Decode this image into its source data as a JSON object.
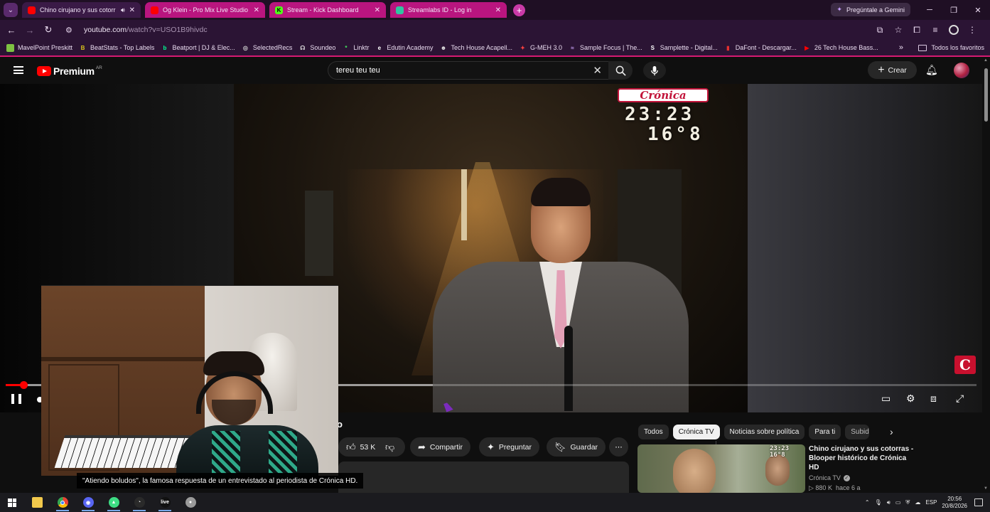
{
  "browser": {
    "tabs": [
      {
        "label": "Chino cirujano y sus cotorr",
        "favicon_color": "#ff0000",
        "active": true,
        "audio": true
      },
      {
        "label": "Og Klein - Pro Mix Live Studio |",
        "favicon_color": "#ff0000",
        "active": false
      },
      {
        "label": "Stream - Kick Dashboard",
        "favicon_color": "#53fc18",
        "favicon_letter": "K",
        "active": false
      },
      {
        "label": "Streamlabs ID - Log in",
        "favicon_color": "#31c3a2",
        "active": false
      }
    ],
    "gemini_label": "Pregúntale a Gemini",
    "url_host": "youtube.com",
    "url_path": "/watch?v=USO1B9hivdc",
    "bookmarks": [
      {
        "label": "MavelPoint Preskitt",
        "color": "#7ec242",
        "glyph": ""
      },
      {
        "label": "BeatStats - Top Labels",
        "color": "#d9c21c",
        "glyph": "B"
      },
      {
        "label": "Beatport | DJ & Elec...",
        "color": "#01ff95",
        "glyph": "b"
      },
      {
        "label": "SelectedRecs",
        "color": "#cccccc",
        "glyph": "◎"
      },
      {
        "label": "Soundeo",
        "color": "#dddddd",
        "glyph": "☊"
      },
      {
        "label": "Linktr",
        "color": "#43e660",
        "glyph": "*"
      },
      {
        "label": "Edutin Academy",
        "color": "#ffffff",
        "glyph": "e"
      },
      {
        "label": "Tech House Acapell...",
        "color": "#dddddd",
        "glyph": "☻"
      },
      {
        "label": "G-MEH 3.0",
        "color": "#ff4040",
        "glyph": "✦"
      },
      {
        "label": "Sample Focus | The...",
        "color": "#cfa8ff",
        "glyph": "≈"
      },
      {
        "label": "Samplette - Digital...",
        "color": "#ffffff",
        "glyph": "S"
      },
      {
        "label": "DaFont - Descargar...",
        "color": "#e53030",
        "glyph": "▮"
      },
      {
        "label": "26 Tech House Bass...",
        "color": "#ff0000",
        "glyph": "▶"
      }
    ],
    "all_bookmarks_label": "Todos los favoritos",
    "accent_color": "#d61a72"
  },
  "youtube": {
    "brand": "Premium",
    "country": "AR",
    "search_value": "tereu teu teu",
    "create_label": "Crear",
    "player": {
      "overlay_logo": "Crónica",
      "overlay_time": "23:23",
      "overlay_temp": "16°8",
      "watermark": "C",
      "progress_played": 0.018,
      "progress_loaded": 0.44
    },
    "title_fragment": "o",
    "likes": "53 K",
    "share_label": "Compartir",
    "ask_label": "Preguntar",
    "save_label": "Guardar",
    "chips": [
      {
        "label": "Todos",
        "active": false
      },
      {
        "label": "Crónica TV",
        "active": true
      },
      {
        "label": "Noticias sobre política",
        "active": false
      },
      {
        "label": "Para ti",
        "active": false
      },
      {
        "label": "Subid",
        "active": false
      }
    ],
    "recommended": {
      "title": "Chino cirujano y sus cotorras - Blooper histórico de Crónica HD",
      "channel": "Crónica TV",
      "views": "880 K",
      "age": "hace 6 a",
      "thumb_stamp_1": "23:23",
      "thumb_stamp_2": "16°8"
    },
    "subtitle": "\"Atiendo boludos\", la famosa respuesta de un entrevistado al periodista de Crónica HD."
  },
  "taskbar": {
    "apps": [
      {
        "name": "file-explorer",
        "color": "#f2c94c",
        "glyph": ""
      },
      {
        "name": "chrome",
        "color": "#4285f4",
        "glyph": "",
        "open": true
      },
      {
        "name": "discord",
        "color": "#5865f2",
        "glyph": "◉",
        "open": true
      },
      {
        "name": "android-studio",
        "color": "#3ddc84",
        "glyph": "▲",
        "open": true
      },
      {
        "name": "obs",
        "color": "#2a2a2a",
        "glyph": "◔",
        "open": true
      },
      {
        "name": "ableton",
        "color": "#111111",
        "glyph": "live",
        "open": true
      },
      {
        "name": "app-7",
        "color": "#9a9a9a",
        "glyph": "●"
      }
    ],
    "lang": "ESP",
    "time": "20:56",
    "date": "20/8/2026"
  }
}
